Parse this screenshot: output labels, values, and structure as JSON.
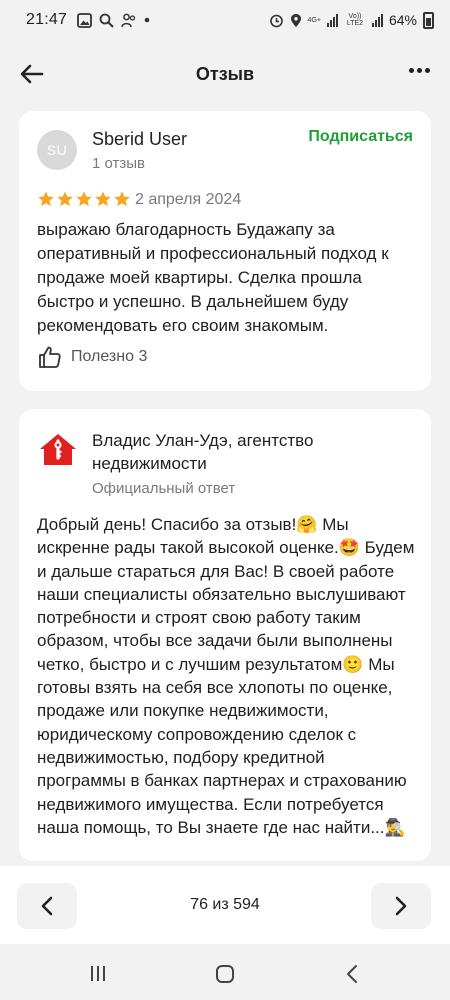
{
  "status_bar": {
    "time": "21:47",
    "network_4g": "4G+",
    "network_volte": "Vo)) LTE2",
    "battery": "64%"
  },
  "appbar": {
    "title": "Отзыв",
    "back_icon": "arrow-left-icon",
    "more_icon": "more-dots-icon"
  },
  "review": {
    "avatar_initials": "SU",
    "author": "Sberid User",
    "reviews_count": "1 отзыв",
    "subscribe_label": "Подписаться",
    "rating": 5,
    "date": "2 апреля 2024",
    "text": "выражаю благодарность Будажапу за оперативный и профессиональный подход к продаже моей квартиры. Сделка прошла быстро и успешно. В дальнейшем буду рекомендовать его своим знакомым.",
    "useful_label": "Полезно 3"
  },
  "reply": {
    "org_name": "Владис Улан-Удэ, агентство недвижимости",
    "official_label": "Официальный ответ",
    "text": "Добрый день! Спасибо за отзыв!🤗 Мы искренне рады такой высокой оценке.🤩 Будем и дальше стараться для Вас! В своей работе наши специалисты обязательно выслушивают потребности и строят свою работу таким образом, чтобы все задачи были выполнены четко, быстро и с лучшим результатом🙂 Мы готовы взять на себя все хлопоты по оценке, продаже или покупке недвижимости, юридическому сопровождению сделок с недвижимостью, подбору кредитной программы в банках партнерах и страхованию недвижимого имущества. Если потребуется наша помощь, то Вы знаете где нас найти...🕵️‍♂️"
  },
  "pager": {
    "label": "76 из 594",
    "prev_icon": "chevron-left-icon",
    "next_icon": "chevron-right-icon"
  },
  "colors": {
    "accent": "#21a038",
    "star": "#f5a623",
    "logo": "#e02020"
  }
}
